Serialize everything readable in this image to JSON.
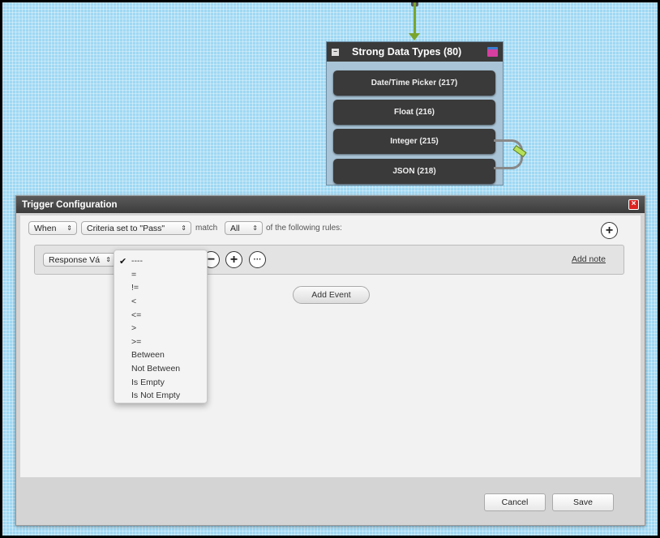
{
  "node": {
    "title": "Strong Data Types (80)",
    "items": [
      {
        "label": "Date/Time Picker (217)"
      },
      {
        "label": "Float (216)"
      },
      {
        "label": "Integer (215)"
      },
      {
        "label": "JSON (218)"
      }
    ]
  },
  "dialog": {
    "title": "Trigger Configuration",
    "when_select": "When",
    "criteria_select": "Criteria set to \"Pass\"",
    "match_label": "match",
    "match_select": "All",
    "rules_label": "of the following rules:",
    "rule": {
      "field_select": "Response Vá",
      "add_note": "Add note"
    },
    "add_event": "Add Event",
    "cancel": "Cancel",
    "save": "Save"
  },
  "operator_dropdown": {
    "selected_index": 0,
    "options": [
      "----",
      "=",
      "!=",
      "<",
      "<=",
      ">",
      ">=",
      "Between",
      "Not Between",
      "Is Empty",
      "Is Not Empty"
    ]
  }
}
